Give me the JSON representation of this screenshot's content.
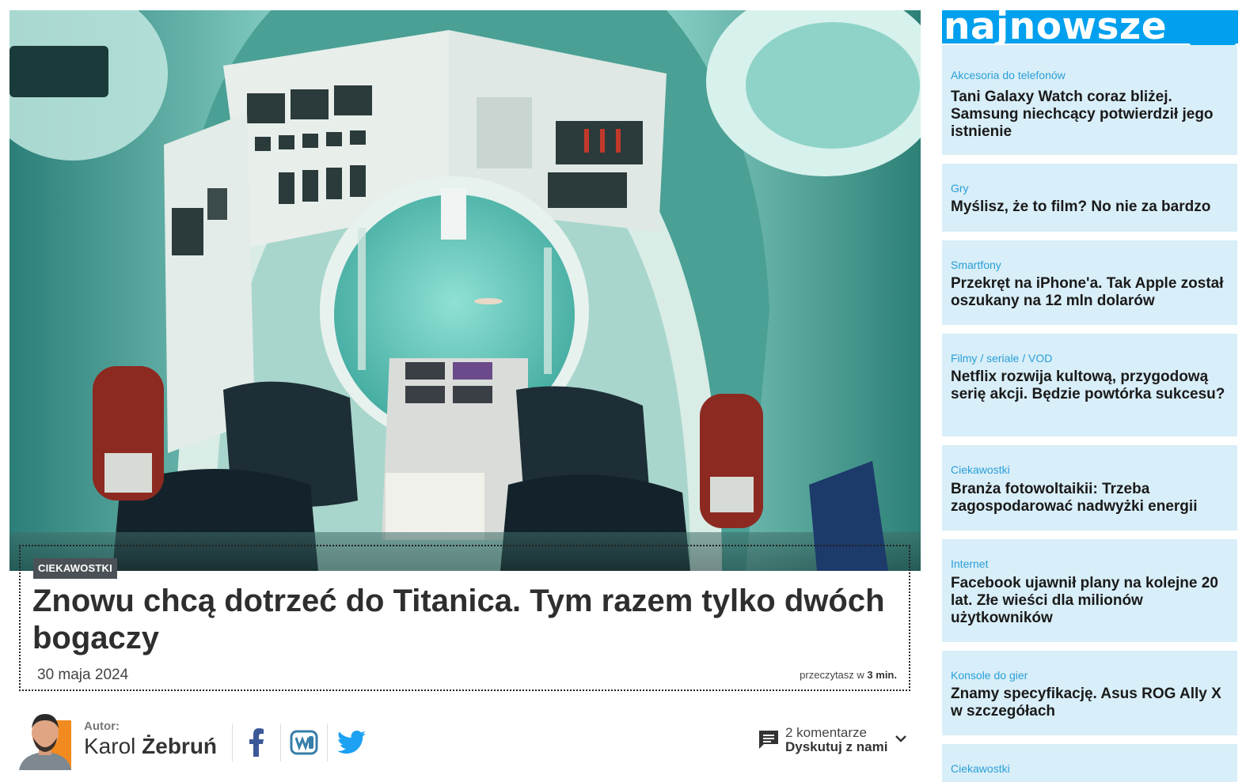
{
  "article": {
    "category": "CIEKAWOSTKI",
    "headline": "Znowu chcą dotrzeć do Titanica. Tym razem tylko dwóch bogaczy",
    "date": "30 maja 2024",
    "read_prefix": "przeczytasz w",
    "read_time": "3 min.",
    "hero_image": "submarine-cockpit-photo"
  },
  "author": {
    "label": "Autor:",
    "first_name": "Karol",
    "last_name": "Żebruń"
  },
  "social": [
    {
      "name": "facebook",
      "icon": "facebook-icon"
    },
    {
      "name": "wykop",
      "icon": "wykop-icon"
    },
    {
      "name": "twitter",
      "icon": "twitter-icon"
    }
  ],
  "comments": {
    "count": "2 komentarze",
    "cta": "Dyskutuj z nami"
  },
  "sidebar": {
    "title": "najnowsze",
    "accent": "#00a0ee",
    "card_bg": "#d8eef8",
    "items": [
      {
        "category": "Akcesoria do telefonów",
        "title": "Tani Galaxy Watch coraz bliżej. Samsung niechcący potwierdził jego istnienie"
      },
      {
        "category": "Gry",
        "title": "Myślisz, że to film? No nie za bardzo"
      },
      {
        "category": "Smartfony",
        "title": "Przekręt na iPhone'a. Tak Apple został oszukany na 12 mln dolarów"
      },
      {
        "category": "Filmy / seriale / VOD",
        "title": "Netflix rozwija kultową, przygodową serię akcji. Będzie powtórka sukcesu?"
      },
      {
        "category": "Ciekawostki",
        "title": "Branża fotowoltaikii: Trzeba zagospodarować nadwyżki energii"
      },
      {
        "category": "Internet",
        "title": "Facebook ujawnił plany na kolejne 20 lat. Złe wieści dla milionów użytkowników"
      },
      {
        "category": "Konsole do gier",
        "title": "Znamy specyfikację. Asus ROG Ally X w szczegółach"
      },
      {
        "category": "Ciekawostki",
        "title": ""
      }
    ]
  }
}
